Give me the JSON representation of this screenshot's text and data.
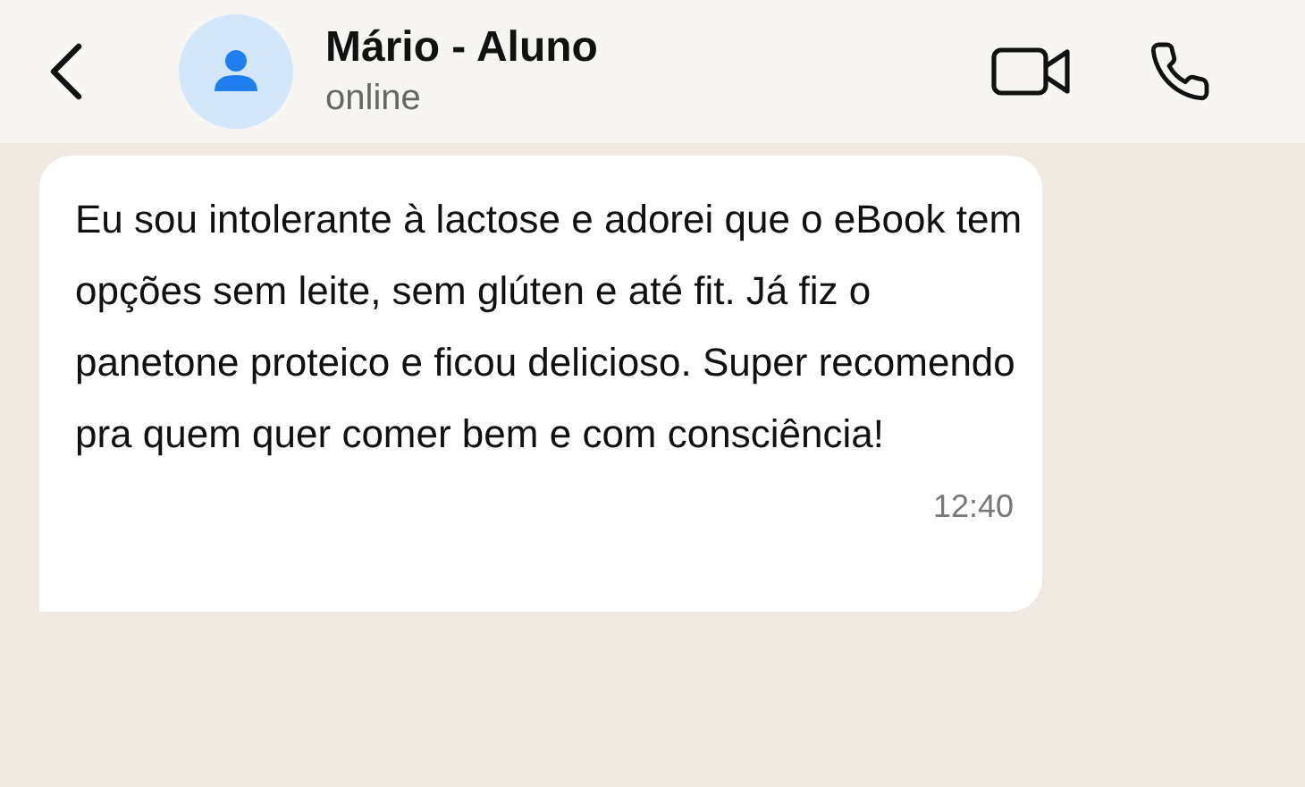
{
  "header": {
    "name": "Mário - Aluno",
    "status": "online"
  },
  "messages": [
    {
      "text": "Eu sou intolerante à lactose e adorei que o eBook tem opções sem leite, sem glúten e até fit. Já fiz o panetone proteico e ficou delicioso. Super recomendo pra quem quer comer bem e com consciência!",
      "time": "12:40"
    }
  ]
}
